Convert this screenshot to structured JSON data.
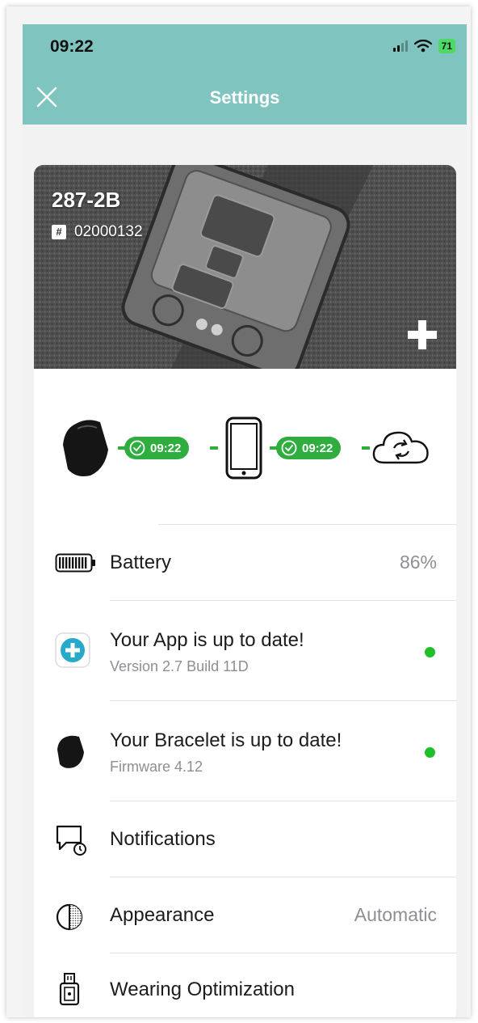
{
  "status_bar": {
    "time": "09:22",
    "battery": "71"
  },
  "header": {
    "title": "Settings"
  },
  "device": {
    "name": "287-2B",
    "serial": "02000132"
  },
  "sync": {
    "bracelet_time": "09:22",
    "cloud_time": "09:22"
  },
  "rows": {
    "battery": {
      "label": "Battery",
      "value": "86%"
    },
    "app": {
      "label": "Your App is up to date!",
      "sub": "Version 2.7 Build 11D"
    },
    "bracelet": {
      "label": "Your Bracelet is up to date!",
      "sub": "Firmware 4.12"
    },
    "notifications": {
      "label": "Notifications"
    },
    "appearance": {
      "label": "Appearance",
      "value": "Automatic"
    },
    "wearing": {
      "label": "Wearing Optimization"
    }
  },
  "colors": {
    "header": "#80c4bf",
    "sync_green": "#2fae3f",
    "status_dot": "#1fbf2a"
  }
}
